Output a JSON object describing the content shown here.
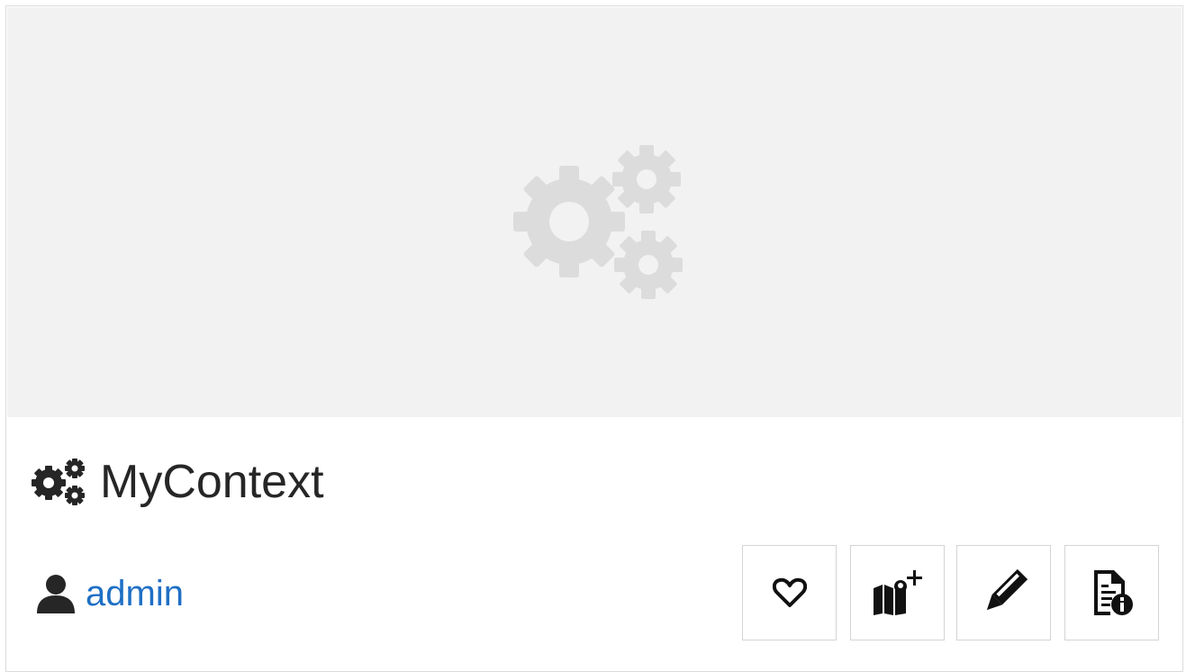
{
  "card": {
    "title": "MyContext",
    "owner": "admin",
    "thumbnail_icon": "gears-icon",
    "title_icon": "gears-icon",
    "owner_icon": "user-icon"
  },
  "actions": [
    {
      "icon": "heart-icon",
      "purpose": "favorite"
    },
    {
      "icon": "map-add-icon",
      "purpose": "add-map"
    },
    {
      "icon": "pencil-icon",
      "purpose": "edit"
    },
    {
      "icon": "document-info-icon",
      "purpose": "details"
    }
  ],
  "colors": {
    "link": "#1f6fc5",
    "thumbnail_background": "#f2f2f2",
    "placeholder_icon": "#dcdcdc",
    "text": "#262626"
  }
}
